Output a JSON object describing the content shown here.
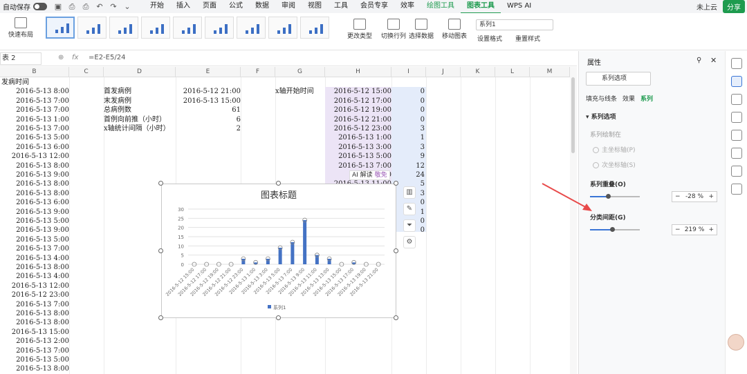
{
  "topbar": {
    "autosave_label": "自动保存",
    "menu": [
      "开始",
      "插入",
      "页面",
      "公式",
      "数据",
      "审阅",
      "视图",
      "工具",
      "会员专享",
      "效率",
      "绘图工具",
      "图表工具",
      "WPS AI"
    ],
    "cloud_label": "未上云",
    "share_label": "分享"
  },
  "ribbon": {
    "layout_label": "快速布局",
    "change_type_label": "更改类型",
    "switch_rowcol_label": "切换行列",
    "select_data_label": "选择数据",
    "move_chart_label": "移动图表",
    "series_select_value": "系列1",
    "set_format_label": "设置格式",
    "reset_style_label": "重置样式"
  },
  "formula_bar": {
    "name_box": "表 2",
    "fx": "fx",
    "formula": "=E2-E5/24"
  },
  "columns": [
    "B",
    "C",
    "D",
    "E",
    "F",
    "G",
    "H",
    "I",
    "J",
    "K",
    "L",
    "M"
  ],
  "col_b_header": "发病时间",
  "col_b": [
    "2016-5-13 8:00",
    "2016-5-13 7:00",
    "2016-5-13 7:00",
    "2016-5-13 1:00",
    "2016-5-13 7:00",
    "2016-5-13 5:00",
    "2016-5-13 6:00",
    "2016-5-13 12:00",
    "2016-5-13 8:00",
    "2016-5-13 9:00",
    "2016-5-13 8:00",
    "2016-5-13 8:00",
    "2016-5-13 6:00",
    "2016-5-13 9:00",
    "2016-5-13 5:00",
    "2016-5-13 9:00",
    "2016-5-13 5:00",
    "2016-5-13 7:00",
    "2016-5-13 4:00",
    "2016-5-13 8:00",
    "2016-5-13 4:00",
    "2016-5-13 12:00",
    "2016-5-12 23:00",
    "2016-5-13 7:00",
    "2016-5-13 8:00",
    "2016-5-13 8:00",
    "2016-5-13 15:00",
    "2016-5-13 2:00",
    "2016-5-13 7:00",
    "2016-5-13 5:00",
    "2016-5-13 8:00"
  ],
  "col_d": [
    "首发病例",
    "末发病例",
    "总病例数",
    "首例向前推（小时）",
    "x轴统计间隔（小时）"
  ],
  "col_e": [
    "2016-5-12 21:00",
    "2016-5-13 15:00",
    "61",
    "6",
    "2"
  ],
  "col_g": [
    "x轴开始时间"
  ],
  "col_h": [
    "2016-5-12 15:00",
    "2016-5-12 17:00",
    "2016-5-12 19:00",
    "2016-5-12 21:00",
    "2016-5-12 23:00",
    "2016-5-13 1:00",
    "2016-5-13 3:00",
    "2016-5-13 5:00",
    "2016-5-13 7:00",
    "20",
    "2016-5-13 11:00"
  ],
  "col_i": [
    "0",
    "0",
    "0",
    "0",
    "3",
    "1",
    "3",
    "9",
    "12",
    "24",
    "5",
    "3",
    "0",
    "1",
    "0",
    "0"
  ],
  "ai_tag": "AI 解读",
  "ai_badge": "敬免",
  "chart_data": {
    "type": "bar",
    "title": "图表标题",
    "categories": [
      "2016-5-12 15:00",
      "2016-5-12 17:00",
      "2016-5-12 19:00",
      "2016-5-12 21:00",
      "2016-5-12 23:00",
      "2016-5-13 1:00",
      "2016-5-13 3:00",
      "2016-5-13 5:00",
      "2016-5-13 7:00",
      "2016-5-13 9:00",
      "2016-5-13 11:00",
      "2016-5-13 13:00",
      "2016-5-13 15:00",
      "2016-5-13 17:00",
      "2016-5-13 19:00",
      "2016-5-13 21:00"
    ],
    "series": [
      {
        "name": "系列1",
        "values": [
          0,
          0,
          0,
          0,
          3,
          1,
          3,
          9,
          12,
          24,
          5,
          3,
          0,
          1,
          0,
          0
        ]
      }
    ],
    "yticks": [
      "0",
      "5",
      "10",
      "15",
      "20",
      "25",
      "30"
    ],
    "ylim": [
      0,
      30
    ],
    "grid": true,
    "legend": "bottom",
    "color": "#4472c4"
  },
  "panel": {
    "title": "属性",
    "dropdown": "系列选项",
    "tabs": [
      "填充与线条",
      "效果",
      "系列"
    ],
    "section": "系列选项",
    "plot_on": "系列绘制在",
    "primary_axis": "主坐标轴(P)",
    "secondary_axis": "次坐标轴(S)",
    "overlap_label": "系列重叠(O)",
    "overlap_value": "-28 %",
    "overlap_fraction": 0.36,
    "gap_label": "分类间距(G)",
    "gap_value": "219 %",
    "gap_fraction": 0.44
  }
}
